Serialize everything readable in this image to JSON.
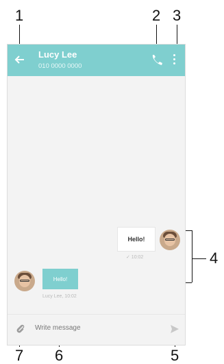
{
  "callouts": [
    "1",
    "2",
    "3",
    "4",
    "5",
    "6",
    "7"
  ],
  "header": {
    "contact_name": "Lucy Lee",
    "contact_number": "010 0000 0000"
  },
  "messages": {
    "outgoing": {
      "text": "Hello!",
      "status": "✓ 10:02"
    },
    "incoming": {
      "text": "Hello!",
      "status": "Lucy Lee, 10:02"
    }
  },
  "composer": {
    "placeholder": "Write message"
  },
  "icons": [
    "back-arrow-icon",
    "phone-call-icon",
    "overflow-menu-icon",
    "attachment-icon",
    "send-icon"
  ],
  "colors": {
    "accent": "#7fcfcf"
  }
}
